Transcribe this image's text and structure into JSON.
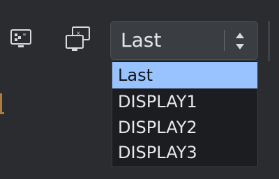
{
  "toolbar": {
    "icons": [
      "monitor-icon",
      "duplicate-display-icon"
    ],
    "combo": {
      "value": "Last",
      "arrows_icon": "up-down-arrows-icon"
    }
  },
  "dropdown": {
    "options": [
      "Last",
      "DISPLAY1",
      "DISPLAY2",
      "DISPLAY3"
    ],
    "selected_index": 0
  },
  "colors": {
    "background": "#2a2c2f",
    "selected": "#99c3ff"
  }
}
